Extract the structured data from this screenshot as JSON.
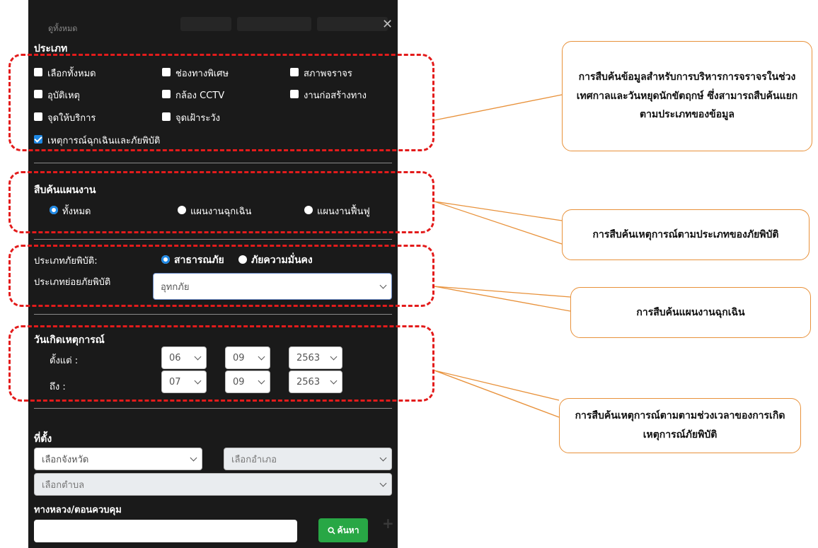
{
  "panel": {
    "view_all": "ดูทั้งหมด"
  },
  "category": {
    "heading": "ประเภท",
    "items": [
      {
        "label": "เลือกทั้งหมด",
        "checked": false
      },
      {
        "label": "ช่องทางพิเศษ",
        "checked": false
      },
      {
        "label": "สภาพจราจร",
        "checked": false
      },
      {
        "label": "อุบัติเหตุ",
        "checked": false
      },
      {
        "label": "กล้อง CCTV",
        "checked": false
      },
      {
        "label": "งานก่อสร้างทาง",
        "checked": false
      },
      {
        "label": "จุดให้บริการ",
        "checked": false
      },
      {
        "label": "จุดเฝ้าระวัง",
        "checked": false
      },
      {
        "label": "เหตุการณ์ฉุกเฉินและภัยพิบัติ",
        "checked": true
      }
    ]
  },
  "plan_search": {
    "heading": "สืบค้นแผนงาน",
    "options": [
      "ทั้งหมด",
      "แผนงานฉุกเฉิน",
      "แผนงานฟื้นฟู"
    ],
    "selected": "ทั้งหมด"
  },
  "disaster": {
    "type_label": "ประเภทภัยพิบัติ:",
    "type_options": [
      "สาธารณภัย",
      "ภัยความมั่นคง"
    ],
    "type_selected": "สาธารณภัย",
    "subtype_label": "ประเภทย่อยภัยพิบัติ",
    "subtype_value": "อุทกภัย"
  },
  "date": {
    "heading": "วันเกิดเหตุการณ์",
    "from_label": "ตั้งแต่ :",
    "to_label": "ถึง :",
    "from": {
      "day": "06",
      "month": "09",
      "year": "2563"
    },
    "to": {
      "day": "07",
      "month": "09",
      "year": "2563"
    }
  },
  "location": {
    "heading": "ที่ตั้ง",
    "province_placeholder": "เลือกจังหวัด",
    "district_placeholder": "เลือกอำเภอ",
    "subdistrict_placeholder": "เลือกตำบล",
    "highway_label": "ทางหลวง/ตอนควบคุม",
    "highway_value": "",
    "search_button": "ค้นหา"
  },
  "callouts": [
    "การสืบค้นข้อมูลสำหรับการบริหารการจราจรในช่วงเทศกาลและวันหยุดนักขัตฤกษ์ ซึ่งสามารถสืบค้นแยกตามประเภทของข้อมูล",
    "การสืบค้นเหตุการณ์ตามประเภทของภัยพิบัติ",
    "การสืบค้นแผนงานฉุกเฉิน",
    "การสืบค้นเหตุการณ์ตามตามช่วงเวลาของการเกิดเหตุการณ์ภัยพิบัติ"
  ],
  "colors": {
    "panel_bg": "#1a1a1a",
    "accent": "#1e88e5",
    "search_button": "#28a745",
    "annotation_dash": "#e31b1b",
    "callout_border": "#e8913a"
  }
}
